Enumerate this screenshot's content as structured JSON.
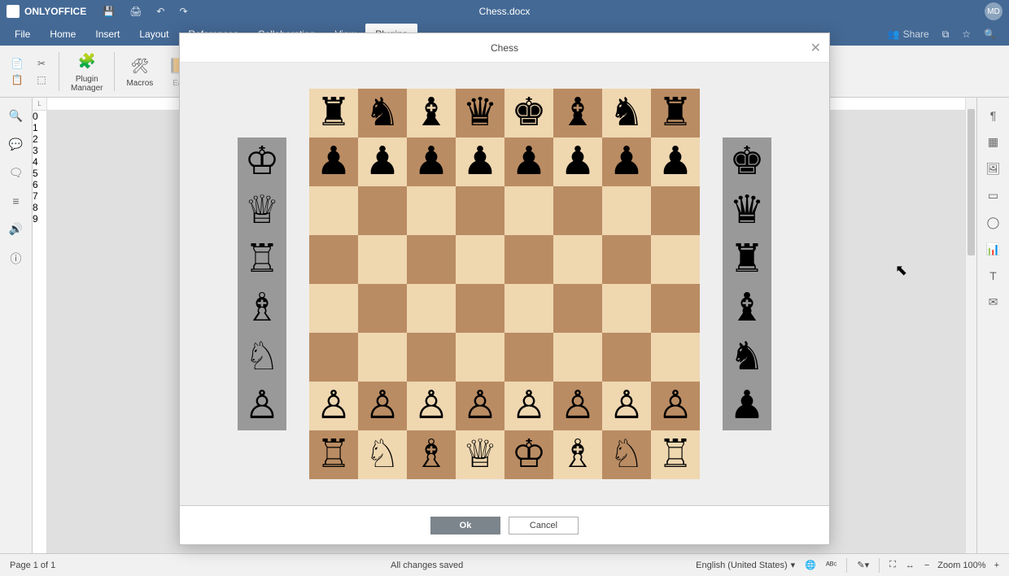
{
  "app": {
    "name": "ONLYOFFICE",
    "doc_title": "Chess.docx",
    "user_initials": "MD"
  },
  "menu": {
    "items": [
      "File",
      "Home",
      "Insert",
      "Layout",
      "References",
      "Collaboration",
      "View",
      "Plugins"
    ],
    "active_index": 7,
    "share": "Share"
  },
  "ribbon": {
    "plugin_manager": "Plugin\nManager",
    "macros": "Macros",
    "easybib": "Ea"
  },
  "modal": {
    "title": "Chess",
    "ok": "Ok",
    "cancel": "Cancel"
  },
  "chess": {
    "position": [
      [
        "bR",
        "bN",
        "bB",
        "bQ",
        "bK",
        "bB",
        "bN",
        "bR"
      ],
      [
        "bP",
        "bP",
        "bP",
        "bP",
        "bP",
        "bP",
        "bP",
        "bP"
      ],
      [
        "",
        "",
        "",
        "",
        "",
        "",
        "",
        ""
      ],
      [
        "",
        "",
        "",
        "",
        "",
        "",
        "",
        ""
      ],
      [
        "",
        "",
        "",
        "",
        "",
        "",
        "",
        ""
      ],
      [
        "",
        "",
        "",
        "",
        "",
        "",
        "",
        ""
      ],
      [
        "wP",
        "wP",
        "wP",
        "wP",
        "wP",
        "wP",
        "wP",
        "wP"
      ],
      [
        "wR",
        "wN",
        "wB",
        "wQ",
        "wK",
        "wB",
        "wN",
        "wR"
      ]
    ],
    "tray_left": [
      "wK",
      "wQ",
      "wR",
      "wB",
      "wN",
      "wP"
    ],
    "tray_right": [
      "bK",
      "bQ",
      "bR",
      "bB",
      "bN",
      "bP"
    ],
    "glyphs": {
      "wK": "♔",
      "wQ": "♕",
      "wR": "♖",
      "wB": "♗",
      "wN": "♘",
      "wP": "♙",
      "bK": "♚",
      "bQ": "♛",
      "bR": "♜",
      "bB": "♝",
      "bN": "♞",
      "bP": "♟"
    }
  },
  "status": {
    "page": "Page 1 of 1",
    "saved": "All changes saved",
    "language": "English (United States)",
    "zoom": "Zoom 100%"
  }
}
